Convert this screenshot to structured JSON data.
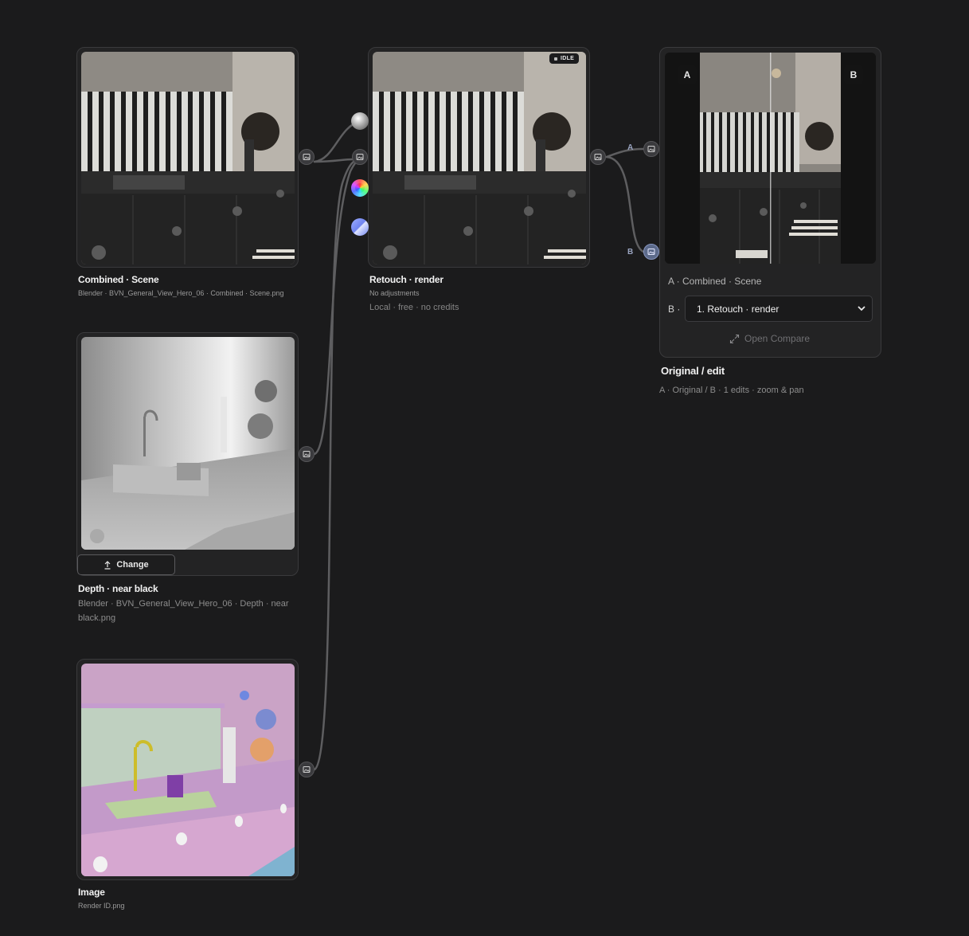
{
  "nodes": {
    "combined": {
      "title": "Combined · Scene",
      "subtitle": "Blender · BVN_General_View_Hero_06 · Combined · Scene.png"
    },
    "depth": {
      "title": "Depth · near black",
      "subtitle": "Blender · BVN_General_View_Hero_06 · Depth · near black.png",
      "change_label": "Change"
    },
    "image": {
      "title": "Image",
      "subtitle": "Render ID.png"
    },
    "retouch": {
      "title": "Retouch · render",
      "subtitle": "No adjustments",
      "meta": "Local · free · no credits",
      "status": "IDLE"
    },
    "compare": {
      "tag_a": "A",
      "tag_b": "B",
      "a_line": "A · Combined · Scene",
      "b_prefix": "B ·",
      "b_selected": "1. Retouch · render",
      "open_compare": "Open Compare",
      "title": "Original / edit",
      "subtitle": "A · Original / B · 1 edits · zoom & pan"
    }
  },
  "wire_labels": {
    "a": "A",
    "b": "B"
  },
  "colors": {
    "background": "#1b1b1c",
    "card": "#232324",
    "active_port": "#5c6a8a"
  },
  "icons": {
    "port": "image-icon",
    "upload": "upload-icon",
    "expand": "expand-icon",
    "chevron": "chevron-down-icon"
  }
}
